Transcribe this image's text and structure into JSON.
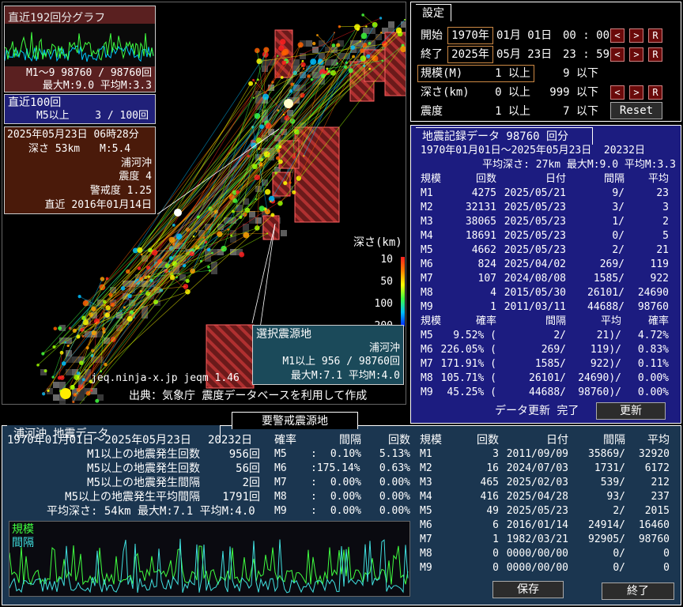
{
  "minigraph": {
    "title": "直近192回分グラフ",
    "line1": "M1～9 98760 / 98760回",
    "line2": "最大M:9.0 平均M:3.3"
  },
  "recent100": {
    "title": "直近100回",
    "label": "M5以上",
    "value": "3 / 100回"
  },
  "latest": {
    "datetime": "2025年05月23日 06時28分",
    "depth": "深さ 53km",
    "mag": "M:5.4",
    "place": "浦河沖",
    "intensity": "震度 4",
    "alert": "警戒度 1.25",
    "recent": "直近 2016年01月14日"
  },
  "depth_legend": {
    "title": "深さ(km)",
    "ticks": [
      "10",
      "50",
      "100",
      "200"
    ]
  },
  "selected": {
    "title": "選択震源地",
    "name": "浦河沖",
    "line1": "M1以上 956 / 98760回",
    "line2": "最大M:7.1 平均M:4.0"
  },
  "map_footer": {
    "credit": "jeq.ninja-x.jp jeqm 1.46",
    "source": "出典：気象庁 震度データベースを利用して作成"
  },
  "settings": {
    "title": "設定",
    "start_label": "開始",
    "start_year": "1970年",
    "start_md": "01月 01日",
    "start_hm": "00 : 00",
    "end_label": "終了",
    "end_year": "2025年",
    "end_md": "05月 23日",
    "end_hm": "23 : 59",
    "mag_label": "規模(M)",
    "mag_min": "1 以上",
    "mag_max": "9 以下",
    "depth_label": "深さ(km)",
    "depth_min": "0 以上",
    "depth_max": "999 以下",
    "int_label": "震度",
    "int_min": "1 以上",
    "int_max": "7 以下",
    "prev": "<",
    "next": ">",
    "reset_r": "R",
    "reset_button": "Reset"
  },
  "eqdata": {
    "title": "地震記録データ  98760 回分",
    "period": "1970年01月01日～2025年05月23日  20232日",
    "avg": "平均深さ: 27km 最大M:9.0 平均M:3.3",
    "headers": [
      "規模",
      "回数",
      "日付",
      "間隔",
      "平均"
    ],
    "rows": [
      [
        "M1",
        "4275",
        "2025/05/21",
        "9/",
        "23"
      ],
      [
        "M2",
        "32131",
        "2025/05/23",
        "3/",
        "3"
      ],
      [
        "M3",
        "38065",
        "2025/05/23",
        "1/",
        "2"
      ],
      [
        "M4",
        "18691",
        "2025/05/23",
        "0/",
        "5"
      ],
      [
        "M5",
        "4662",
        "2025/05/23",
        "2/",
        "21"
      ],
      [
        "M6",
        "824",
        "2025/04/02",
        "269/",
        "119"
      ],
      [
        "M7",
        "107",
        "2024/08/08",
        "1585/",
        "922"
      ],
      [
        "M8",
        "4",
        "2015/05/30",
        "26101/",
        "24690"
      ],
      [
        "M9",
        "1",
        "2011/03/11",
        "44688/",
        "98760"
      ]
    ],
    "prob_headers": [
      "規模",
      "確率",
      "間隔",
      "平均",
      "確率"
    ],
    "prob_rows": [
      [
        "M5",
        "9.52% (",
        "2/",
        "21)/",
        "4.72%"
      ],
      [
        "M6",
        "226.05% (",
        "269/",
        "119)/",
        "0.83%"
      ],
      [
        "M7",
        "171.91% (",
        "1585/",
        "922)/",
        "0.11%"
      ],
      [
        "M8",
        "105.71% (",
        "26101/",
        "24690)/",
        "0.00%"
      ],
      [
        "M9",
        "45.25% (",
        "44688/",
        "98760)/",
        "0.00%"
      ]
    ],
    "status": "データ更新 完了",
    "update_button": "更新"
  },
  "area": {
    "title": "浦河沖 地震データ",
    "tab_alert": "要警戒震源地",
    "period": "1970年01月01日～2025年05月23日",
    "days": "20232日",
    "stats": [
      {
        "label": "M1以上の地震発生回数",
        "value": "956回"
      },
      {
        "label": "M5以上の地震発生回数",
        "value": "56回"
      },
      {
        "label": "M5以上の地震発生間隔",
        "value": "2回"
      },
      {
        "label": "M5以上の地震発生平均間隔",
        "value": "1791回"
      }
    ],
    "avg": "平均深さ: 54km 最大M:7.1 平均M:4.0",
    "prob_headers": [
      "確率",
      "間隔",
      "回数"
    ],
    "prob_rows": [
      [
        "M5",
        ":",
        "0.10%",
        "5.13%"
      ],
      [
        "M6",
        ":175.14%",
        "",
        "0.63%"
      ],
      [
        "M7",
        ":",
        "0.00%",
        "0.00%"
      ],
      [
        "M8",
        ":",
        "0.00%",
        "0.00%"
      ],
      [
        "M9",
        ":",
        "0.00%",
        "0.00%"
      ]
    ],
    "table_headers": [
      "規模",
      "回数",
      "日付",
      "間隔",
      "平均"
    ],
    "table_rows": [
      [
        "M1",
        "3",
        "2011/09/09",
        "35869/",
        "32920"
      ],
      [
        "M2",
        "16",
        "2024/07/03",
        "1731/",
        "6172"
      ],
      [
        "M3",
        "465",
        "2025/02/03",
        "539/",
        "212"
      ],
      [
        "M4",
        "416",
        "2025/04/28",
        "93/",
        "237"
      ],
      [
        "M5",
        "49",
        "2025/05/23",
        "2/",
        "2015"
      ],
      [
        "M6",
        "6",
        "2016/01/14",
        "24914/",
        "16460"
      ],
      [
        "M7",
        "1",
        "1982/03/21",
        "92905/",
        "98760"
      ],
      [
        "M8",
        "0",
        "0000/00/00",
        "0/",
        "0"
      ],
      [
        "M9",
        "0",
        "0000/00/00",
        "0/",
        "0"
      ]
    ],
    "graph_label1": "規模",
    "graph_label2": "間隔",
    "save_button": "保存",
    "exit_button": "終了"
  },
  "colors": {
    "settings_bg": "#000000",
    "data_bg": "#1c1c80",
    "area_bg": "#1b3650",
    "hatch": "#b03030"
  }
}
